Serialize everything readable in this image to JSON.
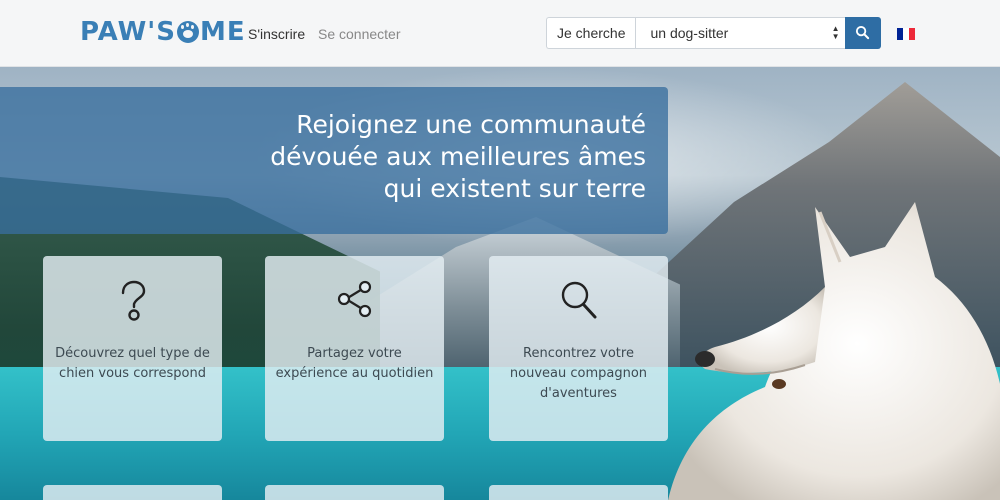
{
  "brand": {
    "name_left": "PAW'S",
    "name_right": "ME"
  },
  "nav": {
    "signup": "S'inscrire",
    "login": "Se connecter"
  },
  "search": {
    "label": "Je cherche",
    "selected": "un dog-sitter",
    "button_icon": "search-icon"
  },
  "language": {
    "icon": "flag-fr-icon",
    "colors": [
      "#002395",
      "#ffffff",
      "#ed2939"
    ]
  },
  "hero": {
    "headline": [
      "Rejoignez une communauté",
      "dévouée aux meilleures âmes",
      "qui existent sur terre"
    ]
  },
  "cards": [
    {
      "icon": "question-icon",
      "text": "Découvrez quel type de chien vous correspond"
    },
    {
      "icon": "share-icon",
      "text": "Partagez votre expérience au quotidien"
    },
    {
      "icon": "magnifier-icon",
      "text": "Rencontrez votre nouveau compagnon d'aventures"
    }
  ],
  "colors": {
    "accent": "#3a7fb6",
    "button": "#2e6da4",
    "overlay": "#386e9e"
  }
}
